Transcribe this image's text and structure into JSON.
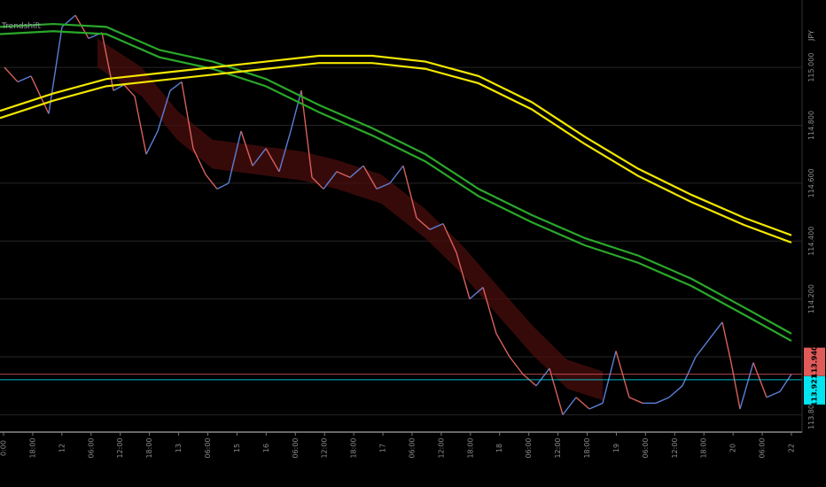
{
  "chart_data": {
    "type": "line",
    "indicator_label": "Trendshift",
    "currency_label": "JPY",
    "y_ticks": [
      "115.000",
      "114.800",
      "114.600",
      "114.400",
      "114.200",
      "113.800"
    ],
    "ylim": [
      113.74,
      115.19
    ],
    "x_ticks": [
      "0:00",
      "18:00",
      "12",
      "06:00",
      "12:00",
      "18:00",
      "13",
      "06:00",
      "15",
      "16",
      "06:00",
      "12:00",
      "18:00",
      "17",
      "06:00",
      "12:00",
      "18:00",
      "18",
      "06:00",
      "12:00",
      "18:00",
      "19",
      "06:00",
      "12:00",
      "18:00",
      "20",
      "06:00",
      "22"
    ],
    "price_tags": [
      {
        "label": "113.940",
        "color": "#e05a5a",
        "value": 113.94
      },
      {
        "label": "113.921",
        "color": "#00e5f0",
        "value": 113.921
      }
    ],
    "series": [
      {
        "color": "#2aa82a",
        "values": [
          [
            0,
            115.14
          ],
          [
            60,
            115.15
          ],
          [
            120,
            115.14
          ],
          [
            180,
            115.06
          ],
          [
            240,
            115.02
          ],
          [
            300,
            114.96
          ],
          [
            360,
            114.87
          ],
          [
            420,
            114.79
          ],
          [
            480,
            114.7
          ],
          [
            540,
            114.58
          ],
          [
            600,
            114.49
          ],
          [
            660,
            114.41
          ],
          [
            720,
            114.35
          ],
          [
            780,
            114.27
          ],
          [
            840,
            114.17
          ],
          [
            893,
            114.08
          ]
        ]
      },
      {
        "color": "#f2e600",
        "values": [
          [
            0,
            114.85
          ],
          [
            60,
            114.91
          ],
          [
            120,
            114.96
          ],
          [
            180,
            114.98
          ],
          [
            240,
            115.0
          ],
          [
            300,
            115.02
          ],
          [
            360,
            115.04
          ],
          [
            420,
            115.04
          ],
          [
            480,
            115.02
          ],
          [
            540,
            114.97
          ],
          [
            600,
            114.88
          ],
          [
            660,
            114.76
          ],
          [
            720,
            114.65
          ],
          [
            780,
            114.56
          ],
          [
            840,
            114.48
          ],
          [
            893,
            114.42
          ]
        ]
      }
    ],
    "price": [
      [
        5,
        115.0
      ],
      [
        20,
        114.95
      ],
      [
        35,
        114.97
      ],
      [
        55,
        114.84
      ],
      [
        70,
        115.14
      ],
      [
        85,
        115.18
      ],
      [
        100,
        115.1
      ],
      [
        115,
        115.12
      ],
      [
        128,
        114.92
      ],
      [
        140,
        114.94
      ],
      [
        152,
        114.9
      ],
      [
        165,
        114.7
      ],
      [
        178,
        114.78
      ],
      [
        192,
        114.92
      ],
      [
        205,
        114.95
      ],
      [
        218,
        114.72
      ],
      [
        232,
        114.63
      ],
      [
        245,
        114.58
      ],
      [
        258,
        114.6
      ],
      [
        272,
        114.78
      ],
      [
        285,
        114.66
      ],
      [
        300,
        114.72
      ],
      [
        315,
        114.64
      ],
      [
        328,
        114.78
      ],
      [
        340,
        114.92
      ],
      [
        352,
        114.62
      ],
      [
        365,
        114.58
      ],
      [
        380,
        114.64
      ],
      [
        395,
        114.62
      ],
      [
        410,
        114.66
      ],
      [
        425,
        114.58
      ],
      [
        440,
        114.6
      ],
      [
        455,
        114.66
      ],
      [
        470,
        114.48
      ],
      [
        485,
        114.44
      ],
      [
        500,
        114.46
      ],
      [
        515,
        114.36
      ],
      [
        530,
        114.2
      ],
      [
        545,
        114.24
      ],
      [
        560,
        114.08
      ],
      [
        575,
        114.0
      ],
      [
        590,
        113.94
      ],
      [
        605,
        113.9
      ],
      [
        620,
        113.96
      ],
      [
        635,
        113.8
      ],
      [
        650,
        113.86
      ],
      [
        665,
        113.82
      ],
      [
        680,
        113.84
      ],
      [
        695,
        114.02
      ],
      [
        710,
        113.86
      ],
      [
        725,
        113.84
      ],
      [
        740,
        113.84
      ],
      [
        755,
        113.86
      ],
      [
        770,
        113.9
      ],
      [
        785,
        114.0
      ],
      [
        800,
        114.06
      ],
      [
        815,
        114.12
      ],
      [
        825,
        113.98
      ],
      [
        835,
        113.82
      ],
      [
        850,
        113.98
      ],
      [
        865,
        113.86
      ],
      [
        880,
        113.88
      ],
      [
        893,
        113.94
      ]
    ]
  }
}
